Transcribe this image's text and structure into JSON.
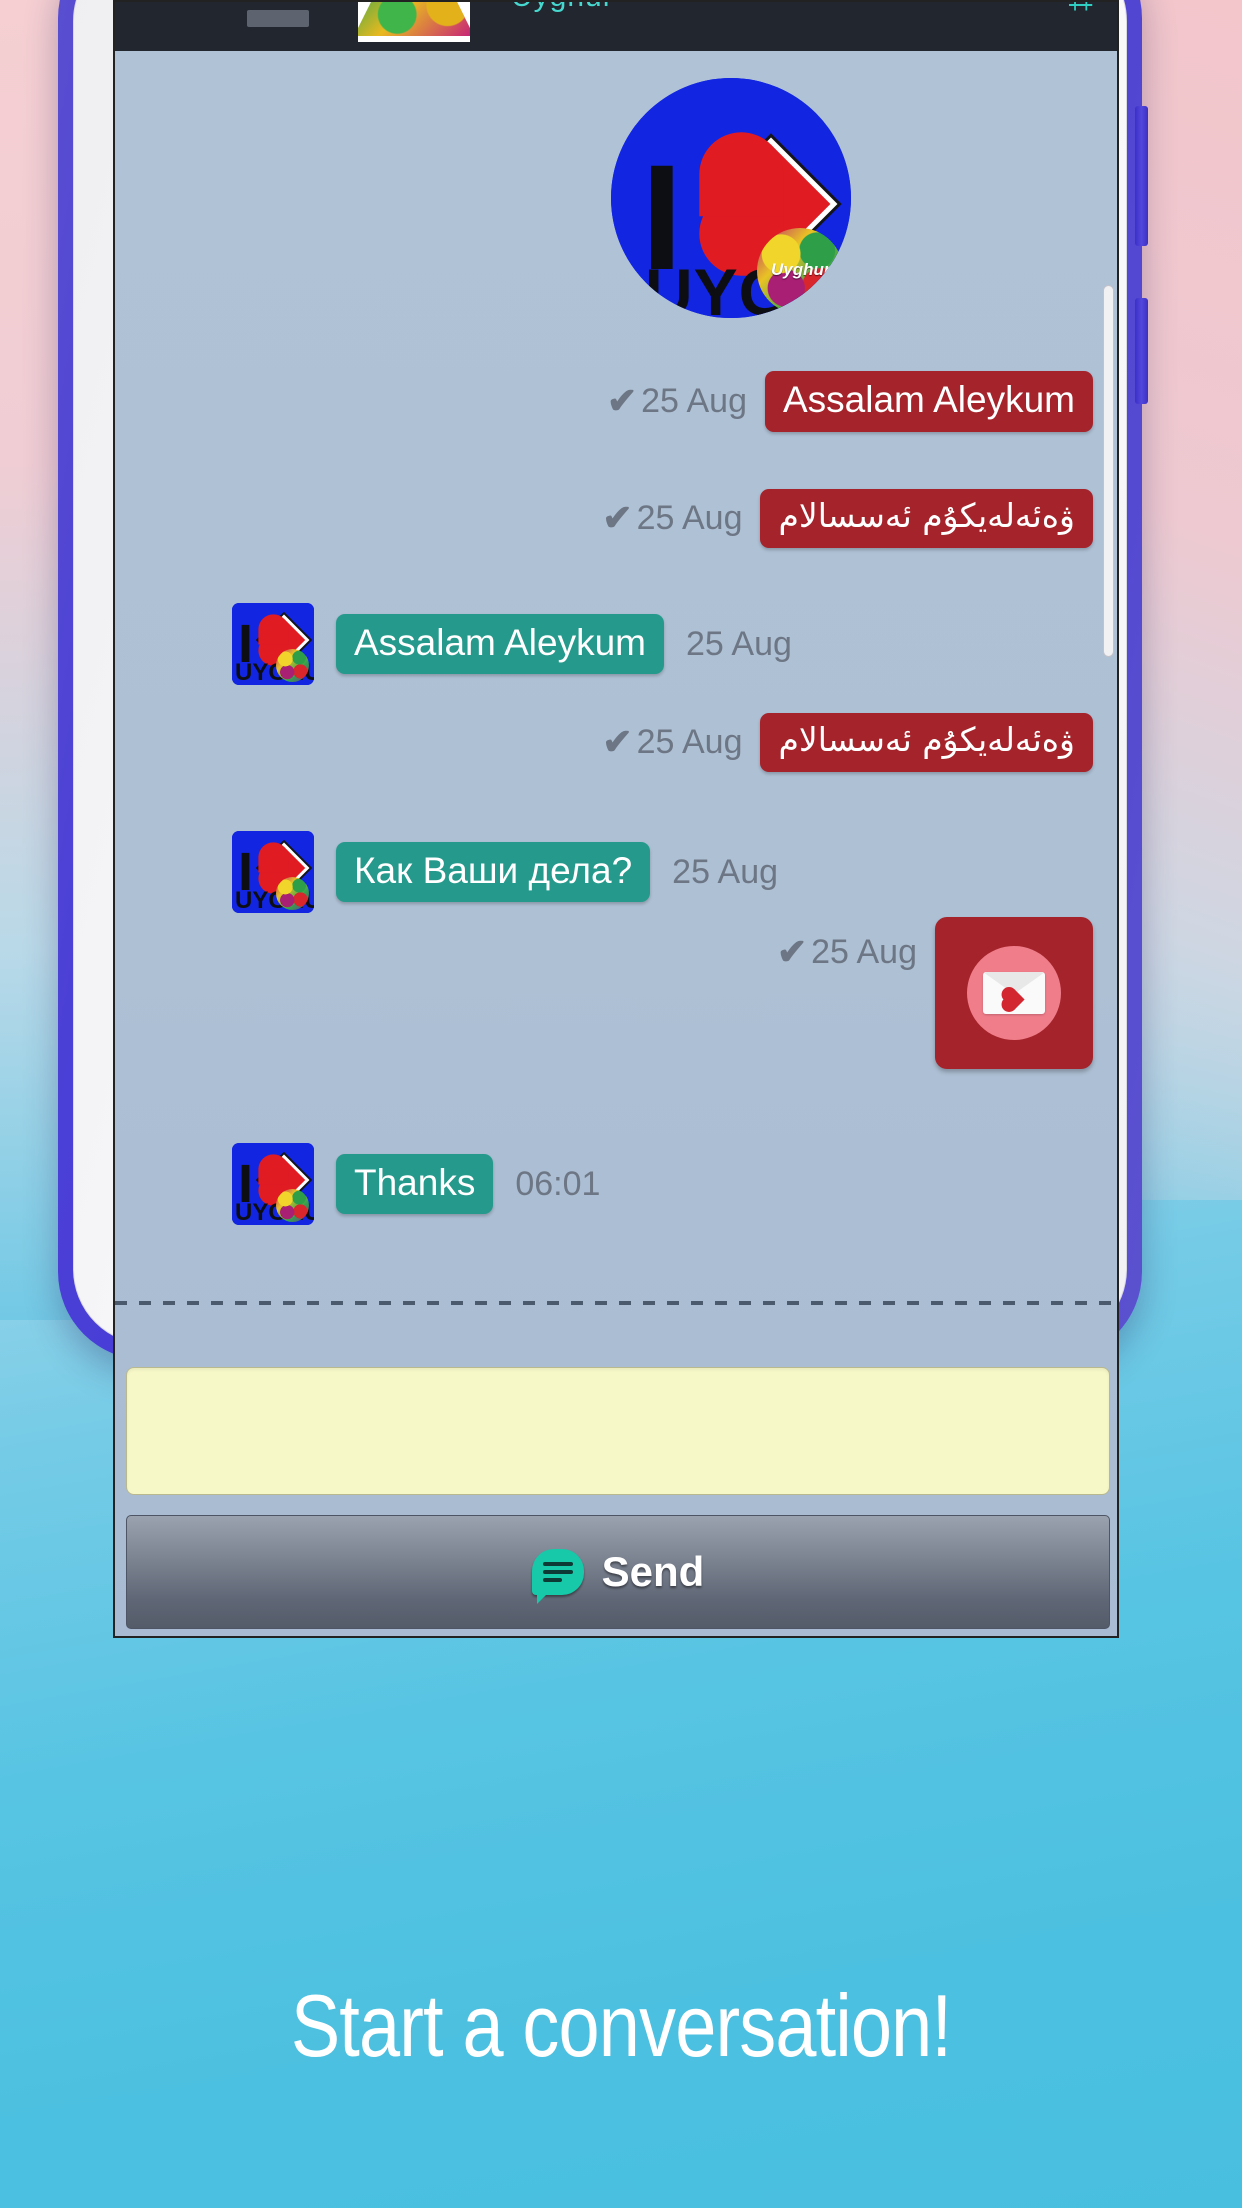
{
  "caption": "Start a conversation!",
  "app": {
    "action_bar": {
      "title": "Uyghur",
      "menu_icon": "more-options-icon",
      "drag_handle_icon": "drag-handle-icon",
      "thumbnail_icon": "contact-thumbnail"
    },
    "header_avatar": {
      "icon": "contact-avatar",
      "art_i": "I",
      "art_word": "UYGHUR",
      "art_badge_text": "UyghurLove"
    },
    "avatar_art": {
      "i": "I",
      "word": "UYGHUR",
      "badge_text": "UyghurLove"
    },
    "messages": [
      {
        "direction": "outgoing",
        "kind": "text",
        "text": "Assalam Aleykum",
        "time": "25 Aug",
        "status": "sent",
        "rtl": false
      },
      {
        "direction": "outgoing",
        "kind": "text",
        "text": "ۋەئەلەيكۇم ئەسسالام",
        "time": "25 Aug",
        "status": "sent",
        "rtl": true
      },
      {
        "direction": "incoming",
        "kind": "text",
        "text": "Assalam Aleykum",
        "time": "25 Aug",
        "status": "",
        "rtl": false
      },
      {
        "direction": "outgoing",
        "kind": "text",
        "text": "ۋەئەلەيكۇم ئەسسالام",
        "time": "25 Aug",
        "status": "sent",
        "rtl": true
      },
      {
        "direction": "incoming",
        "kind": "text",
        "text": "Как Ваши дела?",
        "time": "25 Aug",
        "status": "",
        "rtl": false
      },
      {
        "direction": "outgoing",
        "kind": "sticker",
        "text": "",
        "time": "25 Aug",
        "status": "sent",
        "rtl": false,
        "sticker_icon": "love-letter-sticker"
      },
      {
        "direction": "incoming",
        "kind": "text",
        "text": "Thanks",
        "time": "06:01",
        "status": "",
        "rtl": false
      }
    ],
    "composer": {
      "input_value": "",
      "input_placeholder": "",
      "send_label": "Send",
      "send_icon": "chat-bubble-icon"
    },
    "status_tick_glyph": "✔"
  },
  "colors": {
    "outgoing_bubble": "#a5232a",
    "incoming_bubble": "#259a8c",
    "chat_background": "#aec1d6",
    "action_bar": "#22262f",
    "accent_teal": "#2fcfc3",
    "input_background": "#f7f8c8",
    "caption_color": "#ffffff",
    "page_background": "#4cc0e0",
    "phone_frame": "#4337d8"
  }
}
